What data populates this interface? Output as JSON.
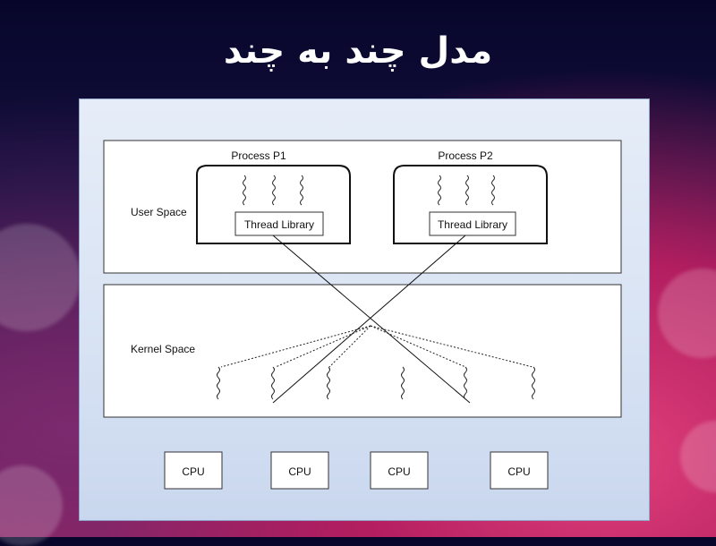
{
  "title": "مدل چند به چند",
  "diagram": {
    "user_space_label": "User Space",
    "kernel_space_label": "Kernel Space",
    "processes": [
      {
        "name": "Process P1",
        "library": "Thread Library",
        "user_threads": 3
      },
      {
        "name": "Process P2",
        "library": "Thread Library",
        "user_threads": 3
      }
    ],
    "kernel_threads": 6,
    "cpus": [
      "CPU",
      "CPU",
      "CPU",
      "CPU"
    ]
  }
}
